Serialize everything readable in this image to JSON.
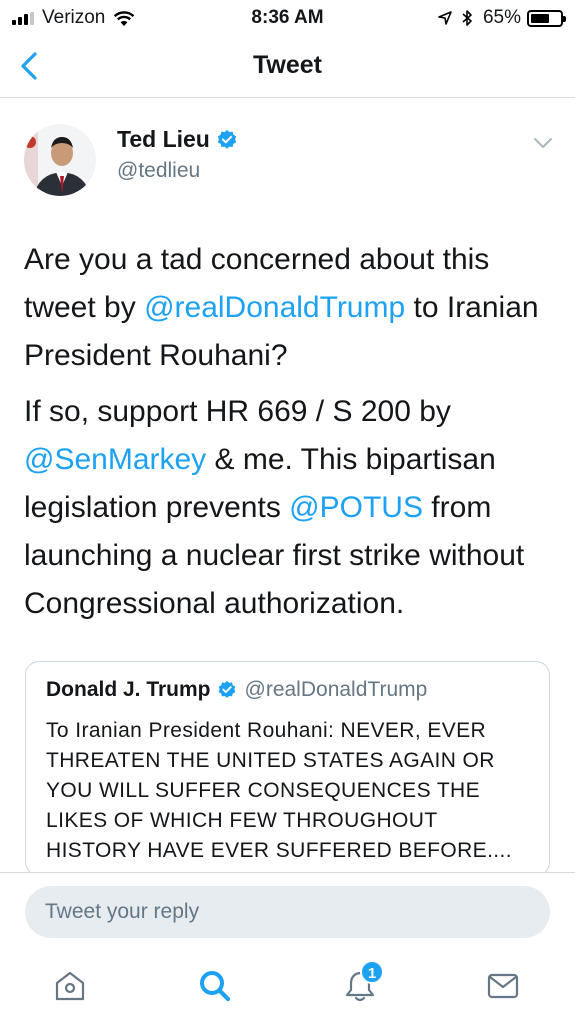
{
  "status_bar": {
    "carrier": "Verizon",
    "time": "8:36 AM",
    "battery_percent": "65%",
    "battery_level": 0.65,
    "signal_bars_active": 3,
    "icons": [
      "signal-icon",
      "wifi-icon",
      "location-icon",
      "bluetooth-icon",
      "battery-icon"
    ]
  },
  "nav": {
    "title": "Tweet",
    "back_icon": "chevron-left-icon"
  },
  "tweet": {
    "author_name": "Ted Lieu",
    "author_handle": "@tedlieu",
    "verified": true,
    "paragraph1": {
      "part1": "Are you a tad concerned about this tweet by ",
      "mention1": "@realDonaldTrump",
      "part2": " to Iranian President Rouhani?"
    },
    "paragraph2": {
      "part1": "If so, support HR 669 / S 200 by ",
      "mention1": "@SenMarkey",
      "part2": " & me. This bipartisan legislation prevents ",
      "mention2": "@POTUS",
      "part3": " from launching a nuclear first strike without Congressional authorization."
    }
  },
  "quoted_tweet": {
    "author_name": "Donald J. Trump",
    "author_handle": "@realDonaldTrump",
    "verified": true,
    "text": "To Iranian President Rouhani: NEVER, EVER THREATEN THE UNITED STATES AGAIN OR YOU WILL SUFFER CONSEQUENCES THE LIKES OF WHICH FEW THROUGHOUT HISTORY HAVE EVER SUFFERED BEFORE...."
  },
  "reply": {
    "placeholder": "Tweet your reply"
  },
  "tab_bar": {
    "items": [
      "home-icon",
      "search-icon",
      "notifications-icon",
      "messages-icon"
    ],
    "notification_badge": "1"
  },
  "colors": {
    "link": "#1da1f2",
    "secondary_text": "#657786",
    "border": "#ccd6dd",
    "reply_bg": "#e6ecf0"
  }
}
